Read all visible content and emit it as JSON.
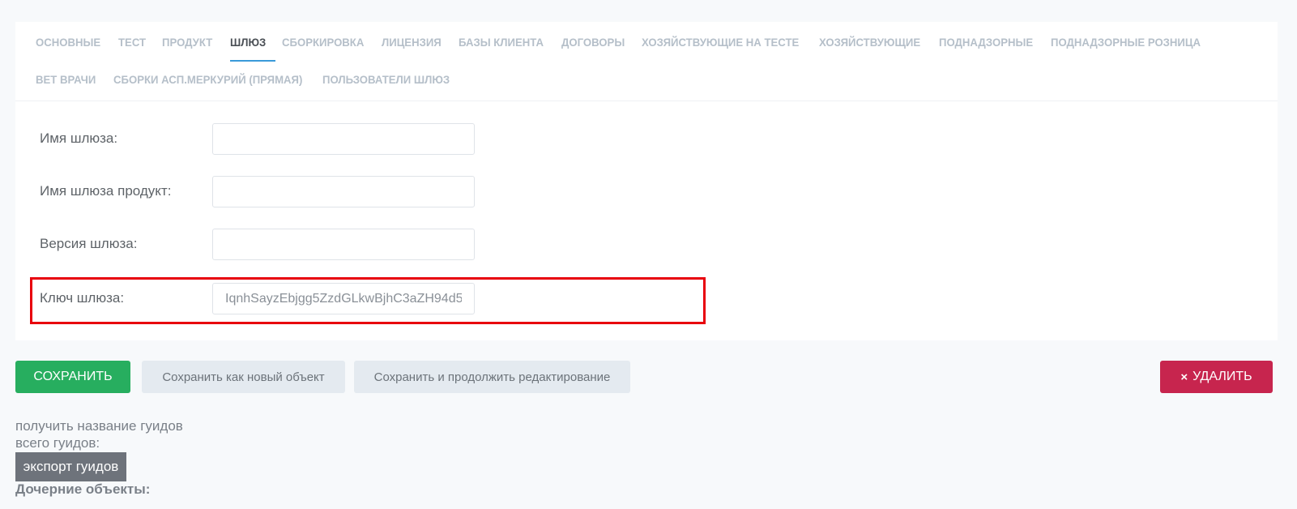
{
  "tabs": [
    {
      "label": "ОСНОВНЫЕ",
      "active": false
    },
    {
      "label": "ТЕСТ",
      "active": false
    },
    {
      "label": "ПРОДУКТ",
      "active": false
    },
    {
      "label": "ШЛЮЗ",
      "active": true
    },
    {
      "label": "СБОРКИРОВКА",
      "active": false
    },
    {
      "label": "ЛИЦЕНЗИЯ",
      "active": false
    },
    {
      "label": "БАЗЫ КЛИЕНТА",
      "active": false
    },
    {
      "label": "ДОГОВОРЫ",
      "active": false
    },
    {
      "label": "ХОЗЯЙСТВУЮЩИЕ НА ТЕСТЕ",
      "active": false
    },
    {
      "label": "ХОЗЯЙСТВУЮЩИЕ",
      "active": false
    },
    {
      "label": "ПОДНАДЗОРНЫЕ",
      "active": false
    },
    {
      "label": "ПОДНАДЗОРНЫЕ РОЗНИЦА",
      "active": false
    },
    {
      "label": "ВЕТ ВРАЧИ",
      "active": false
    },
    {
      "label": "СБОРКИ АСП.МЕРКУРИЙ (ПРЯМАЯ)",
      "active": false
    },
    {
      "label": "ПОЛЬЗОВАТЕЛИ ШЛЮЗ",
      "active": false
    }
  ],
  "form": {
    "fields": [
      {
        "label": "Имя шлюза:",
        "value": ""
      },
      {
        "label": "Имя шлюза продукт:",
        "value": ""
      },
      {
        "label": "Версия шлюза:",
        "value": ""
      },
      {
        "label": "Ключ шлюза:",
        "value": "IqnhSayzEbjgg5ZzdGLkwBjhC3aZH94d5"
      }
    ]
  },
  "actions": {
    "save": "СОХРАНИТЬ",
    "save_as_new": "Сохранить как новый объект",
    "save_and_continue": "Сохранить и продолжить редактирование",
    "delete": "УДАЛИТЬ",
    "delete_icon": "×"
  },
  "guids": {
    "get_names": "получить название гуидов",
    "total": "всего гуидов:",
    "export": "экспорт гуидов"
  },
  "child_objects_title": "Дочерние объекты:",
  "colors": {
    "save": "#27ae5f",
    "delete": "#c7254e",
    "highlight": "#e8000d",
    "active_tab_underline": "#3a9ad9"
  }
}
